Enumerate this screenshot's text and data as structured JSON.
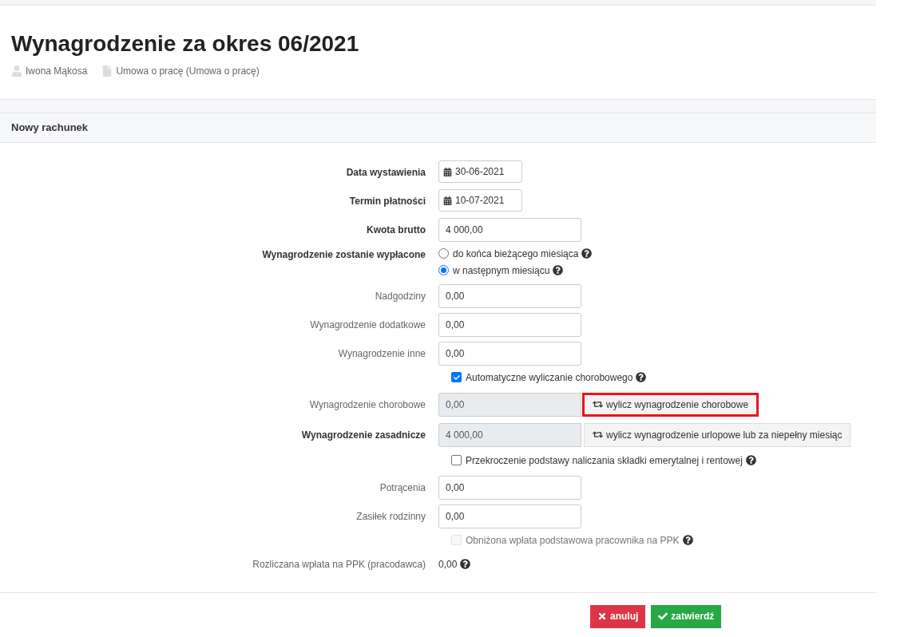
{
  "header": {
    "title": "Wynagrodzenie za okres 06/2021",
    "person": "Iwona Mąkosa",
    "contract": "Umowa o pracę (Umowa o pracę)"
  },
  "section": {
    "title": "Nowy rachunek"
  },
  "rows": [
    {
      "kind": "date",
      "label": "Data wystawienia",
      "bold": true,
      "value": "30-06-2021"
    },
    {
      "kind": "date",
      "label": "Termin płatności",
      "bold": true,
      "value": "10-07-2021"
    },
    {
      "kind": "input",
      "label": "Kwota brutto",
      "bold": true,
      "value": "4 000,00"
    },
    {
      "kind": "radio",
      "label": "Wynagrodzenie zostanie wypłacone",
      "bold": true,
      "options": [
        {
          "label": "do końca bieżącego miesiąca",
          "selected": false,
          "help": true
        },
        {
          "label": "w następnym miesiącu",
          "selected": true,
          "help": true
        }
      ]
    },
    {
      "kind": "input",
      "label": "Nadgodziny",
      "bold": false,
      "value": "0,00"
    },
    {
      "kind": "input",
      "label": "Wynagrodzenie dodatkowe",
      "bold": false,
      "value": "0,00"
    },
    {
      "kind": "input",
      "label": "Wynagrodzenie inne",
      "bold": false,
      "value": "0,00"
    },
    {
      "kind": "checkbox",
      "label": "Automatyczne wyliczanie chorobowego",
      "checked": true,
      "disabled": false,
      "help": true
    },
    {
      "kind": "readonly",
      "label": "Wynagrodzenie chorobowe",
      "bold": false,
      "value": "0,00",
      "button": "wylicz wynagrodzenie chorobowe",
      "highlighted": true
    },
    {
      "kind": "readonly",
      "label": "Wynagrodzenie zasadnicze",
      "bold": true,
      "value": "4 000,00",
      "button": "wylicz wynagrodzenie urlopowe lub za niepełny miesiąc",
      "highlighted": false
    },
    {
      "kind": "checkbox",
      "label": "Przekroczenie podstawy naliczania składki emerytalnej i rentowej",
      "checked": false,
      "disabled": false,
      "help": true
    },
    {
      "kind": "input",
      "label": "Potrącenia",
      "bold": false,
      "value": "0,00"
    },
    {
      "kind": "input",
      "label": "Zasiłek rodzinny",
      "bold": false,
      "value": "0,00"
    },
    {
      "kind": "checkbox",
      "label": "Obniżona wpłata podstawowa pracownika na PPK",
      "checked": false,
      "disabled": true,
      "help": true
    },
    {
      "kind": "text",
      "label": "Rozliczana wpłata na PPK (pracodawca)",
      "bold": false,
      "value": "0,00",
      "help": true
    }
  ],
  "buttons": [
    {
      "kind": "cancel",
      "label": "anuluj"
    },
    {
      "kind": "confirm",
      "label": "zatwierdź"
    }
  ]
}
